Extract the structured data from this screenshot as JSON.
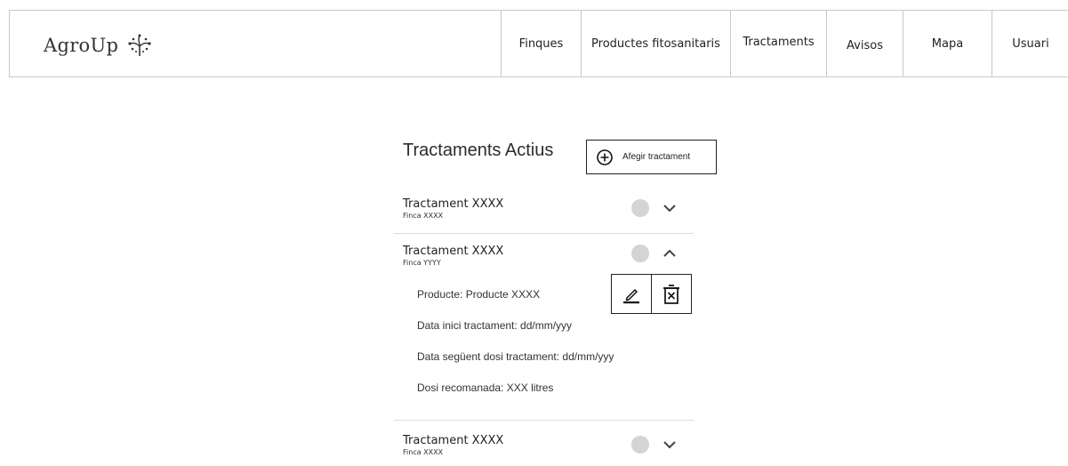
{
  "header": {
    "logo_text": "AgroUp",
    "logo_icon": "sprout-icon",
    "nav": [
      {
        "label": "Finques"
      },
      {
        "label": "Productes fitosanitaris"
      },
      {
        "label": "Tractaments"
      },
      {
        "label": "Avisos"
      },
      {
        "label": "Mapa"
      },
      {
        "label": "Usuari"
      }
    ]
  },
  "main": {
    "title": "Tractaments Actius",
    "add_button_label": "Afegir tractament",
    "treatments": [
      {
        "title": "Tractament XXXX",
        "subtitle": "Finca XXXX",
        "expanded": false
      },
      {
        "title": "Tractament XXXX",
        "subtitle": "Finca YYYY",
        "expanded": true,
        "details": [
          "Producte: Producte XXXX",
          "Data inici tractament: dd/mm/yyy",
          "Data següent dosi tractament: dd/mm/yyy",
          "Dosi recomanada: XXX litres"
        ]
      },
      {
        "title": "Tractament XXXX",
        "subtitle": "Finca XXXX",
        "expanded": false
      }
    ]
  },
  "colors": {
    "status_dot": "#d4d4d4",
    "border": "#c8c8c8"
  }
}
